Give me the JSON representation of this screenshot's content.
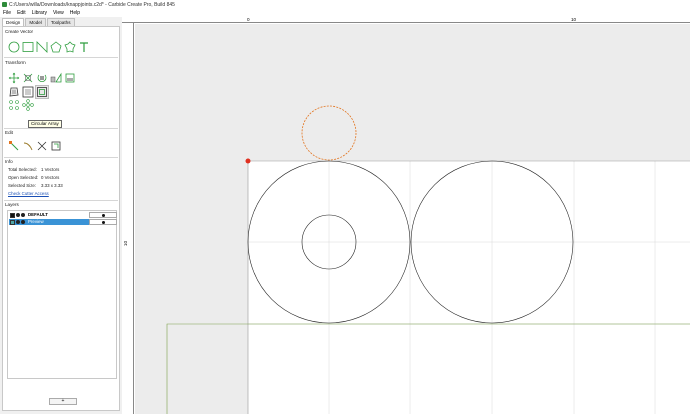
{
  "window": {
    "title": "C:/Users/willa/Downloads/knappjoints.c2d* - Carbide Create Pro, Build 845"
  },
  "menu": [
    "File",
    "Edit",
    "Library",
    "View",
    "Help"
  ],
  "tabs": [
    {
      "label": "Design",
      "active": true
    },
    {
      "label": "Model",
      "active": false
    },
    {
      "label": "Toolpaths",
      "active": false
    }
  ],
  "sections": {
    "create_vector": "Create Vector",
    "transform": "Transform",
    "edit": "Edit",
    "info": "Info",
    "layers": "Layers"
  },
  "tooltip": "Circular Array",
  "info": {
    "total_selected_label": "Total Selected:",
    "total_selected_value": "1 Vectors",
    "open_selected_label": "Open Selected:",
    "open_selected_value": "0 Vectors",
    "selected_size_label": "Selected Size:",
    "selected_size_value": "3.33 x 3.33",
    "check_cutter_access": "Check Cutter Access"
  },
  "layers": [
    {
      "name": "DEFAULT",
      "selected": false,
      "swatch": "#111111"
    },
    {
      "name": "Preview",
      "selected": true,
      "swatch": "#4fa6a6"
    }
  ],
  "add_layer_label": "+",
  "rulers": {
    "top": [
      "0",
      "10"
    ],
    "left": [
      "10"
    ]
  },
  "colors": {
    "accent_green": "#2f9e3f",
    "selection_blue": "#3a93d6",
    "preview_orange": "#e2741f",
    "origin_red": "#e03020"
  }
}
